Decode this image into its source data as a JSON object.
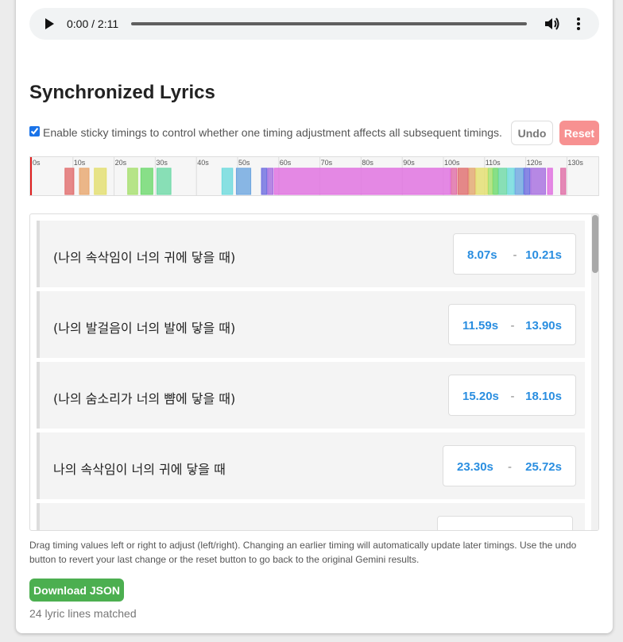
{
  "player": {
    "time_display": "0:00 / 2:11",
    "play_icon": "play-icon",
    "volume_icon": "volume-icon",
    "more_icon": "more-vertical-icon"
  },
  "section_title": "Synchronized Lyrics",
  "sticky": {
    "checked": true,
    "label": "Enable sticky timings to control whether one timing adjustment affects all subsequent timings."
  },
  "buttons": {
    "undo": "Undo",
    "reset": "Reset",
    "download": "Download JSON"
  },
  "timeline": {
    "duration": 131,
    "ticks": [
      "0s",
      "10s",
      "20s",
      "30s",
      "40s",
      "50s",
      "60s",
      "70s",
      "80s",
      "90s",
      "100s",
      "110s",
      "120s",
      "130s"
    ],
    "segments": [
      {
        "start": 8.07,
        "end": 10.21,
        "color": "#e26d6d"
      },
      {
        "start": 11.59,
        "end": 13.9,
        "color": "#e8a66d"
      },
      {
        "start": 15.2,
        "end": 18.1,
        "color": "#e3df6d"
      },
      {
        "start": 23.3,
        "end": 25.72,
        "color": "#a6e06d"
      },
      {
        "start": 26.5,
        "end": 29.4,
        "color": "#6dd96d"
      },
      {
        "start": 30.4,
        "end": 33.8,
        "color": "#6dd9a6"
      },
      {
        "start": 46.2,
        "end": 48.8,
        "color": "#6ddbdd"
      },
      {
        "start": 49.7,
        "end": 53.2,
        "color": "#6da6e0"
      },
      {
        "start": 55.8,
        "end": 57.1,
        "color": "#6d6de0"
      },
      {
        "start": 57.3,
        "end": 58.6,
        "color": "#a66de0"
      },
      {
        "start": 58.9,
        "end": 101.7,
        "color": "#e06de0"
      },
      {
        "start": 101.9,
        "end": 103.2,
        "color": "#e06da6"
      },
      {
        "start": 103.5,
        "end": 106.0,
        "color": "#e06d6d"
      },
      {
        "start": 106.2,
        "end": 107.7,
        "color": "#e3a66d"
      },
      {
        "start": 107.9,
        "end": 110.7,
        "color": "#e3df6d"
      },
      {
        "start": 110.9,
        "end": 111.9,
        "color": "#a6e06d"
      },
      {
        "start": 112.1,
        "end": 113.2,
        "color": "#6dd96d"
      },
      {
        "start": 113.4,
        "end": 115.4,
        "color": "#6dd9a6"
      },
      {
        "start": 115.6,
        "end": 117.2,
        "color": "#6ddbdd"
      },
      {
        "start": 117.4,
        "end": 119.4,
        "color": "#6da6e0"
      },
      {
        "start": 119.6,
        "end": 121.0,
        "color": "#6d6de0"
      },
      {
        "start": 121.2,
        "end": 124.8,
        "color": "#a66de0"
      },
      {
        "start": 125.3,
        "end": 126.5,
        "color": "#e06de0"
      },
      {
        "start": 128.5,
        "end": 129.7,
        "color": "#e06da6"
      }
    ]
  },
  "lyrics": [
    {
      "text": "(나의 속삭임이 너의 귀에 닿을 때)",
      "start": "8.07s",
      "end": "10.21s"
    },
    {
      "text": "(나의 발걸음이 너의 발에 닿을 때)",
      "start": "11.59s",
      "end": "13.90s"
    },
    {
      "text": "(나의 숨소리가 너의 뺨에 닿을 때)",
      "start": "15.20s",
      "end": "18.10s"
    },
    {
      "text": "나의 속삭임이 너의 귀에 닿을 때",
      "start": "23.30s",
      "end": "25.72s"
    }
  ],
  "help_text": "Drag timing values left or right to adjust (left/right). Changing an earlier timing will automatically update later timings. Use the undo button to revert your last change or the reset button to go back to the original Gemini results.",
  "matched_text": "24 lyric lines matched"
}
